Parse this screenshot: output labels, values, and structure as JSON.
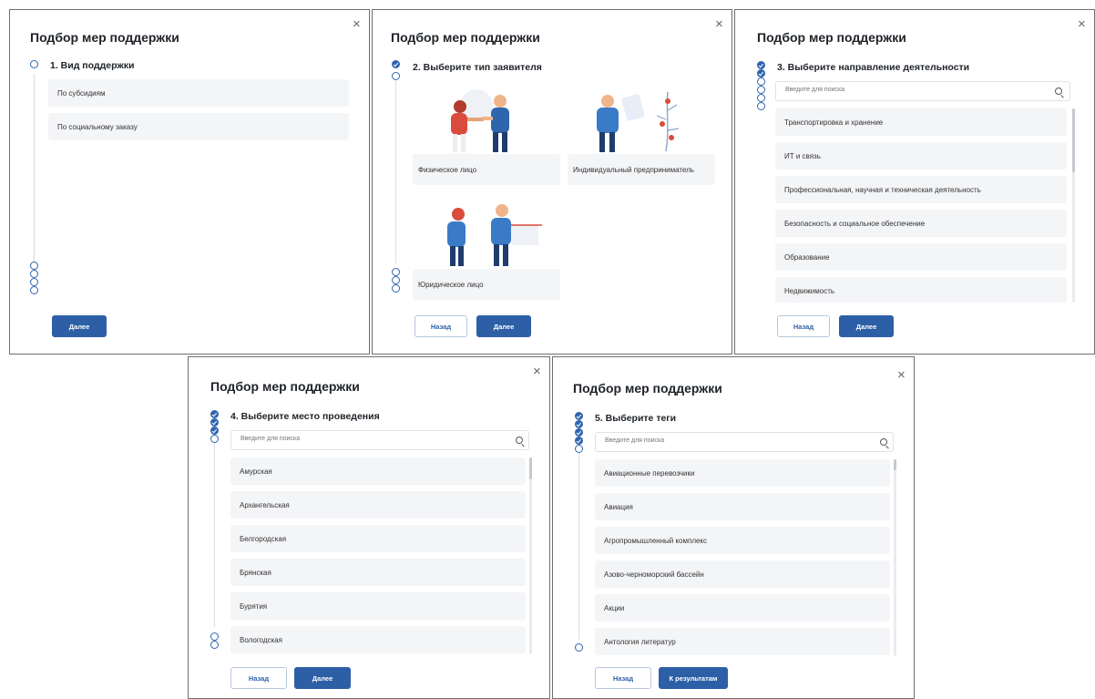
{
  "common": {
    "title": "Подбор мер поддержки",
    "close_glyph": "×",
    "back_label": "Назад",
    "next_label": "Далее",
    "search_placeholder": "Введите для поиска"
  },
  "panel1": {
    "step_title": "1. Вид поддержки",
    "options": [
      "По субсидиям",
      "По социальному заказу"
    ]
  },
  "panel2": {
    "step_title": "2. Выберите тип заявителя",
    "cards": [
      "Физическое лицо",
      "Индивидуальный предприниматель",
      "Юридическое лицо"
    ]
  },
  "panel3": {
    "step_title": "3. Выберите направление деятельности",
    "options": [
      "Транспортировка и хранение",
      "ИТ и связь",
      "Профессиональная, научная и техническая деятельность",
      "Безопасность и социальное обеспечение",
      "Образование",
      "Недвижимость"
    ]
  },
  "panel4": {
    "step_title": "4. Выберите место проведения",
    "options": [
      "Амурская",
      "Архангельская",
      "Белгородская",
      "Брянская",
      "Бурятия",
      "Вологодская"
    ]
  },
  "panel5": {
    "step_title": "5. Выберите теги",
    "options": [
      "Авиационные перевозчики",
      "Авиация",
      "Агропромышленный комплекс",
      "Азово-черноморский бассейн",
      "Акции",
      "Антология литератур"
    ],
    "results_label": "К результатам"
  },
  "colors": {
    "accent": "#2d5fa6",
    "option_bg": "#f4f5f7",
    "border": "#6f6f6f"
  }
}
